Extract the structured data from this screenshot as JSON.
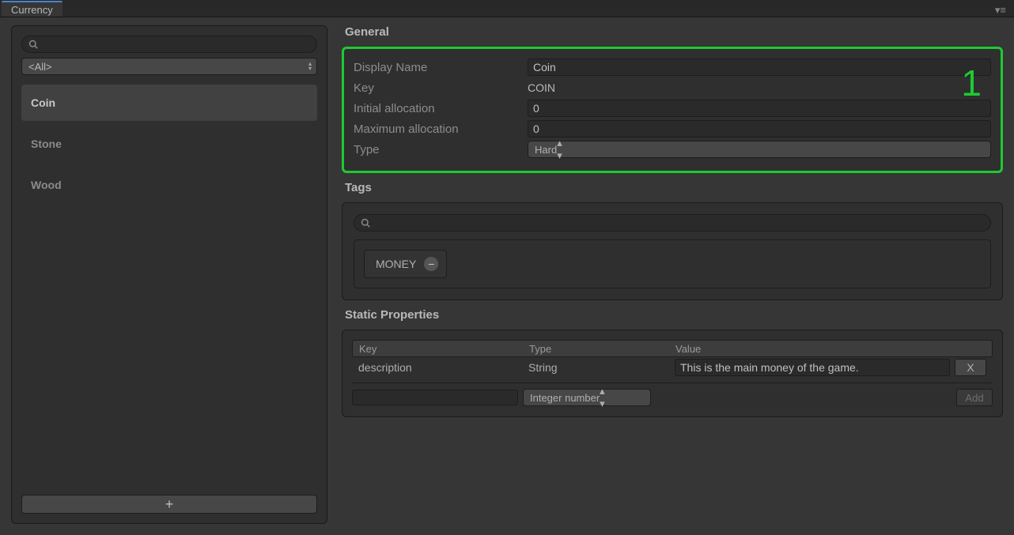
{
  "tab": {
    "title": "Currency"
  },
  "sidebar": {
    "filter": {
      "value": "<All>"
    },
    "items": [
      {
        "label": "Coin"
      },
      {
        "label": "Stone"
      },
      {
        "label": "Wood"
      }
    ],
    "add_symbol": "+"
  },
  "highlight_number": "1",
  "general": {
    "title": "General",
    "labels": {
      "display_name": "Display Name",
      "key": "Key",
      "initial": "Initial allocation",
      "maximum": "Maximum allocation",
      "type": "Type"
    },
    "values": {
      "display_name": "Coin",
      "key": "COIN",
      "initial": "0",
      "maximum": "0",
      "type": "Hard"
    }
  },
  "tags": {
    "title": "Tags",
    "items": [
      {
        "label": "MONEY"
      }
    ]
  },
  "static_props": {
    "title": "Static Properties",
    "headers": {
      "key": "Key",
      "type": "Type",
      "value": "Value"
    },
    "rows": [
      {
        "key": "description",
        "type": "String",
        "value": "This is the main money of the game."
      }
    ],
    "new_row": {
      "type_default": "Integer number",
      "add_label": "Add"
    },
    "remove_label": "X"
  }
}
